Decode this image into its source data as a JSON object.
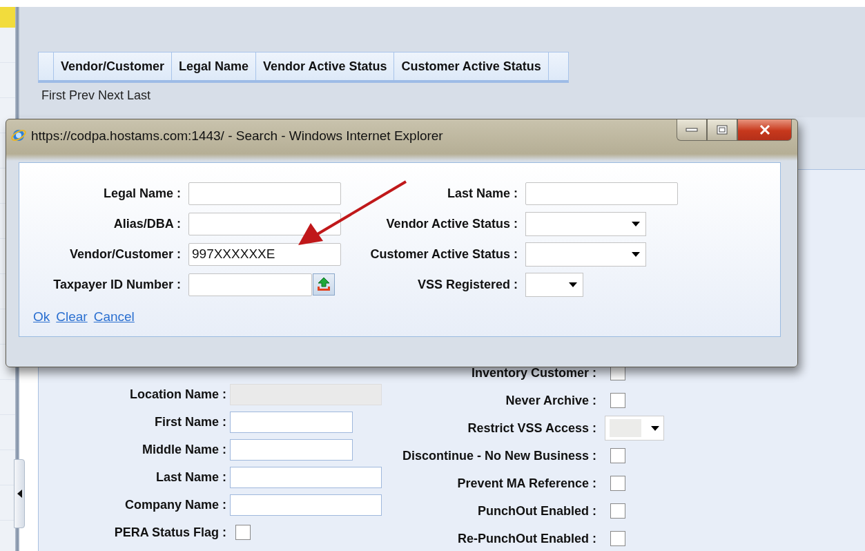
{
  "table": {
    "columns": [
      "Vendor/Customer",
      "Legal Name",
      "Vendor Active Status",
      "Customer Active Status"
    ]
  },
  "pager": [
    "First",
    "Prev",
    "Next",
    "Last"
  ],
  "form": {
    "left": [
      {
        "label": "Location Name :",
        "kind": "text",
        "wide": true,
        "disabled": true
      },
      {
        "label": "First Name :",
        "kind": "text",
        "wide": false,
        "disabled": false
      },
      {
        "label": "Middle Name :",
        "kind": "text",
        "wide": false,
        "disabled": false
      },
      {
        "label": "Last Name :",
        "kind": "text",
        "wide": true,
        "disabled": false
      },
      {
        "label": "Company Name :",
        "kind": "text",
        "wide": true,
        "disabled": false
      },
      {
        "label": "PERA Status Flag :",
        "kind": "checkbox",
        "checked": false,
        "disabled": false
      }
    ],
    "right": [
      {
        "label": "Inventory Customer :",
        "kind": "checkbox",
        "checked": false,
        "disabled": false
      },
      {
        "label": "Never Archive :",
        "kind": "checkbox",
        "checked": false,
        "disabled": false
      },
      {
        "label": "Restrict VSS Access :",
        "kind": "select",
        "disabled": true
      },
      {
        "label": "Discontinue - No New Business :",
        "kind": "checkbox",
        "checked": false,
        "disabled": false
      },
      {
        "label": "Prevent MA Reference :",
        "kind": "checkbox",
        "checked": false,
        "disabled": false
      },
      {
        "label": "PunchOut Enabled :",
        "kind": "checkbox",
        "checked": false,
        "disabled": false
      },
      {
        "label": "Re-PunchOut Enabled :",
        "kind": "checkbox",
        "checked": false,
        "disabled": false
      }
    ]
  },
  "dialog": {
    "title": "https://codpa.hostams.com:1443/ - Search - Windows Internet Explorer",
    "left_fields": [
      {
        "label": "Legal Name :",
        "kind": "text"
      },
      {
        "label": "Alias/DBA :",
        "kind": "text"
      },
      {
        "label": "Vendor/Customer :",
        "kind": "text",
        "value": "997XXXXXXE"
      },
      {
        "label": "Taxpayer ID Number :",
        "kind": "upload"
      }
    ],
    "right_fields": [
      {
        "label": "Last Name :",
        "kind": "text"
      },
      {
        "label": "Vendor Active Status :",
        "kind": "select"
      },
      {
        "label": "Customer Active Status :",
        "kind": "select"
      },
      {
        "label": "VSS Registered :",
        "kind": "small-select"
      }
    ],
    "links": [
      "Ok",
      "Clear",
      "Cancel"
    ]
  }
}
